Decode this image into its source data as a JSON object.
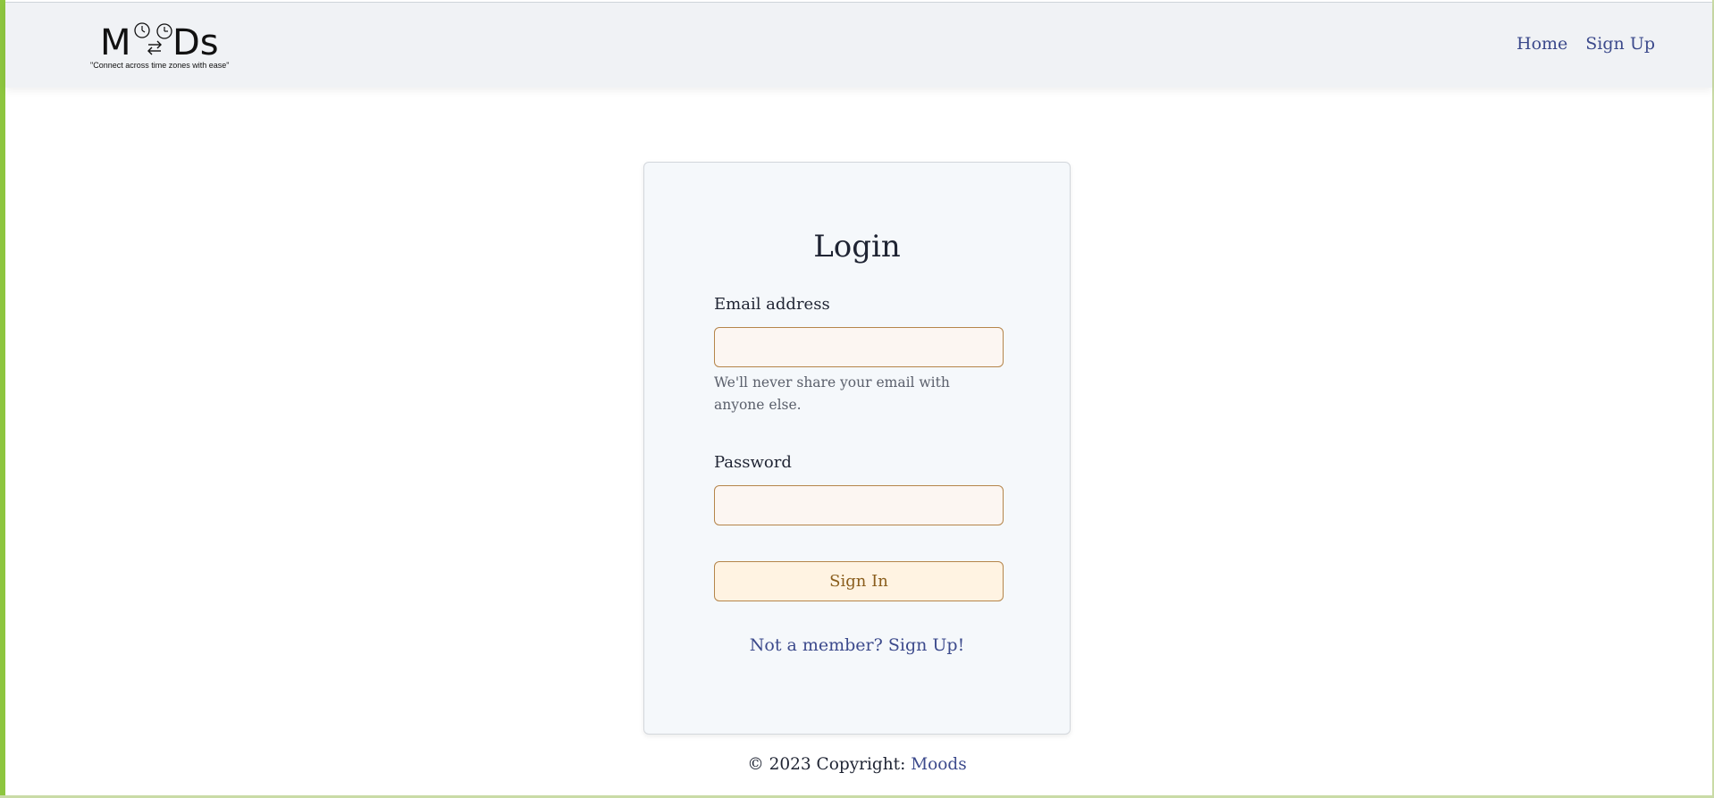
{
  "brand": {
    "logo_text": "MoDs",
    "tagline": "\"Connect across time zones with ease\""
  },
  "nav": {
    "home_label": "Home",
    "signup_label": "Sign Up"
  },
  "login": {
    "title": "Login",
    "email_label": "Email address",
    "email_value": "",
    "email_help": "We'll never share your email with anyone else.",
    "password_label": "Password",
    "password_value": "",
    "signin_label": "Sign In",
    "signup_prompt": "Not a member? Sign Up!"
  },
  "footer": {
    "copyright_text": "© 2023 Copyright: ",
    "brand_link": "Moods"
  },
  "colors": {
    "accent_green": "#8dc63f",
    "link_blue": "#3c4a8c",
    "input_border": "#b5854a",
    "button_bg": "#fff3e2"
  },
  "icons": [
    "clock-icon",
    "swap-arrows-icon"
  ]
}
